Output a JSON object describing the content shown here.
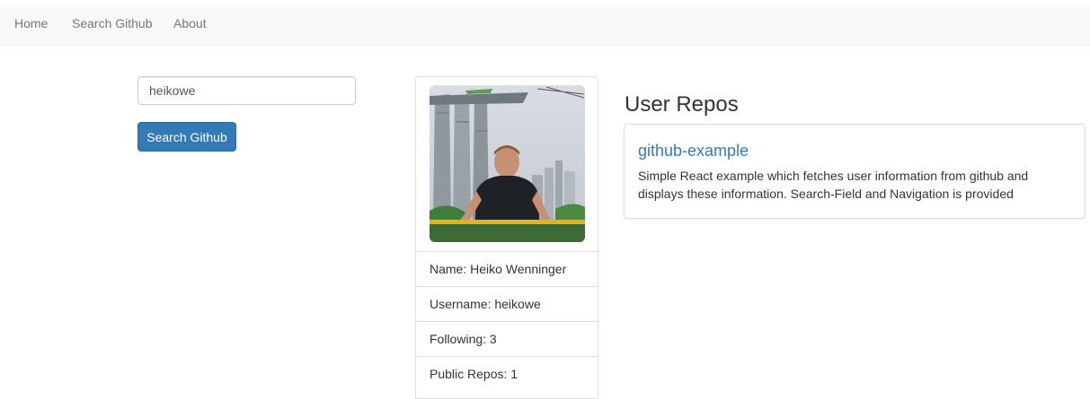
{
  "nav": {
    "items": [
      {
        "label": "Home"
      },
      {
        "label": "Search Github"
      },
      {
        "label": "About"
      }
    ]
  },
  "search": {
    "value": "heikowe",
    "button_label": "Search Github"
  },
  "profile": {
    "name": "Name: Heiko Wenninger",
    "username": "Username: heikowe",
    "following": "Following: 3",
    "public_repos": "Public Repos: 1"
  },
  "repos": {
    "title": "User Repos",
    "items": [
      {
        "name": "github-example",
        "description": "Simple React example which fetches user information from github and displays these information. Search-Field and Navigation is provided"
      }
    ]
  },
  "colors": {
    "primary": "#337ab7",
    "navbar_bg": "#f8f8f8",
    "border": "#dddddd"
  }
}
